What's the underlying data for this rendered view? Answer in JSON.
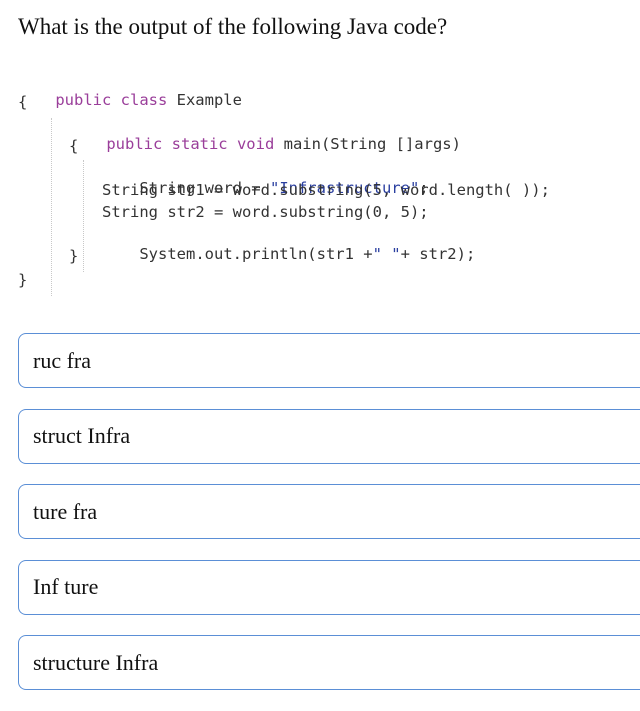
{
  "question": "What is the output of the following Java code?",
  "code": {
    "line1": {
      "kw": "public class",
      "rest": " Example"
    },
    "line2": "{",
    "line3": {
      "kw": "public static void",
      "rest": " main(String []args)"
    },
    "line4": "{",
    "line5": {
      "a": "String word = ",
      "s": "\"Infrastructure\"",
      "b": ";"
    },
    "line6": "String str1 = word.substring(5, word.length( ));",
    "line7": "String str2 = word.substring(0, 5);",
    "line8": {
      "a": "System.out.println(str1 +",
      "s": "\" \"",
      "b": "+ str2);"
    },
    "line9": "}",
    "line10": "}"
  },
  "options": [
    {
      "label": "ruc fra"
    },
    {
      "label": "struct Infra"
    },
    {
      "label": "ture fra"
    },
    {
      "label": "Inf ture"
    },
    {
      "label": "structure Infra"
    }
  ],
  "colors": {
    "keyword": "#9a3e9a",
    "string": "#2a3fa0",
    "option_border": "#5b8fd6"
  }
}
